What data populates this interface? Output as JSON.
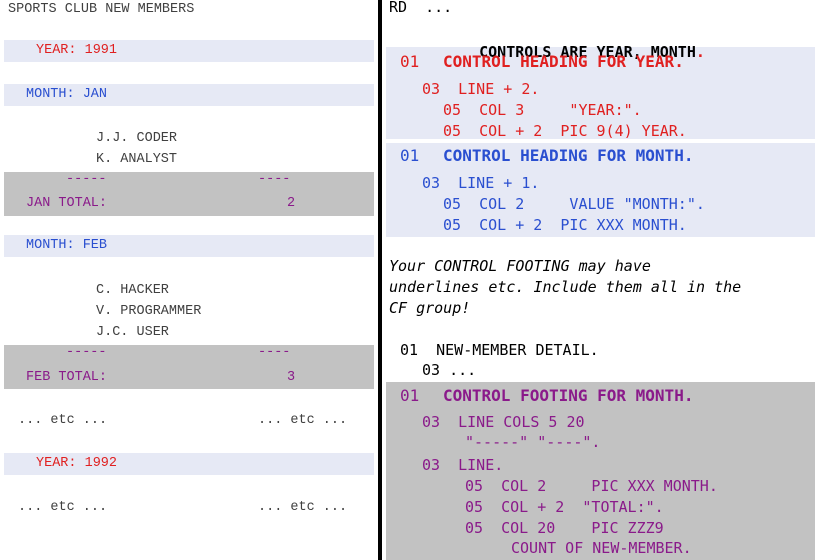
{
  "colors": {
    "year": "#e02020",
    "month": "#2a4fd0",
    "footing": "#8a1a8a",
    "text": "#404040",
    "black": "#000000",
    "band_light": "#e6e9f5",
    "band_gray": "#c2c2c2"
  },
  "report": {
    "title": "SPORTS CLUB NEW MEMBERS",
    "year_1991": "YEAR: 1991",
    "month_jan": "MONTH: JAN",
    "jan_member_1": "J.J. CODER",
    "jan_member_2": "K. ANALYST",
    "jan_underline_1": "-----",
    "jan_underline_2": "----",
    "jan_total_label": "JAN TOTAL:",
    "jan_total_value": "2",
    "month_feb": "MONTH: FEB",
    "feb_member_1": "C. HACKER",
    "feb_member_2": "V. PROGRAMMER",
    "feb_member_3": "J.C. USER",
    "feb_underline_1": "-----",
    "feb_underline_2": "----",
    "feb_total_label": "FEB TOTAL:",
    "feb_total_value": "3",
    "etc_left_1": "... etc ...",
    "etc_right_1": "... etc ...",
    "year_1992": "YEAR: 1992",
    "etc_left_2": "... etc ...",
    "etc_right_2": "... etc ..."
  },
  "code": {
    "rd_line": "RD  ...",
    "controls_line": "CONTROLS ARE YEAR, MONTH",
    "controls_dot": ".",
    "year_level": "01",
    "year_heading": "CONTROL HEADING FOR YEAR.",
    "year_line": "03  LINE + 2.",
    "year_col3": "05  COL 3     \"YEAR:\".",
    "year_pic": "05  COL + 2  PIC 9(4) YEAR.",
    "month_level": "01",
    "month_heading": "CONTROL HEADING FOR MONTH.",
    "month_line": "03  LINE + 1.",
    "month_col2": "05  COL 2     VALUE \"MONTH:\".",
    "month_pic": "05  COL + 2  PIC XXX MONTH.",
    "note_1": "Your CONTROL FOOTING may have",
    "note_2": "underlines etc. Include them all in the",
    "note_3": "CF group!",
    "detail_line": "01  NEW-MEMBER DETAIL.",
    "detail_sub": "03 ...",
    "footing_level": "01",
    "footing_heading": "CONTROL FOOTING FOR MONTH.",
    "footing_line_cols": "03  LINE COLS 5 20",
    "footing_underlines": "\"-----\" \"----\".",
    "footing_line": "03  LINE.",
    "footing_col2": "05  COL 2     PIC XXX MONTH.",
    "footing_total": "05  COL + 2  \"TOTAL:\".",
    "footing_col20": "05  COL 20    PIC ZZZ9",
    "footing_count": "COUNT OF NEW-MEMBER."
  }
}
